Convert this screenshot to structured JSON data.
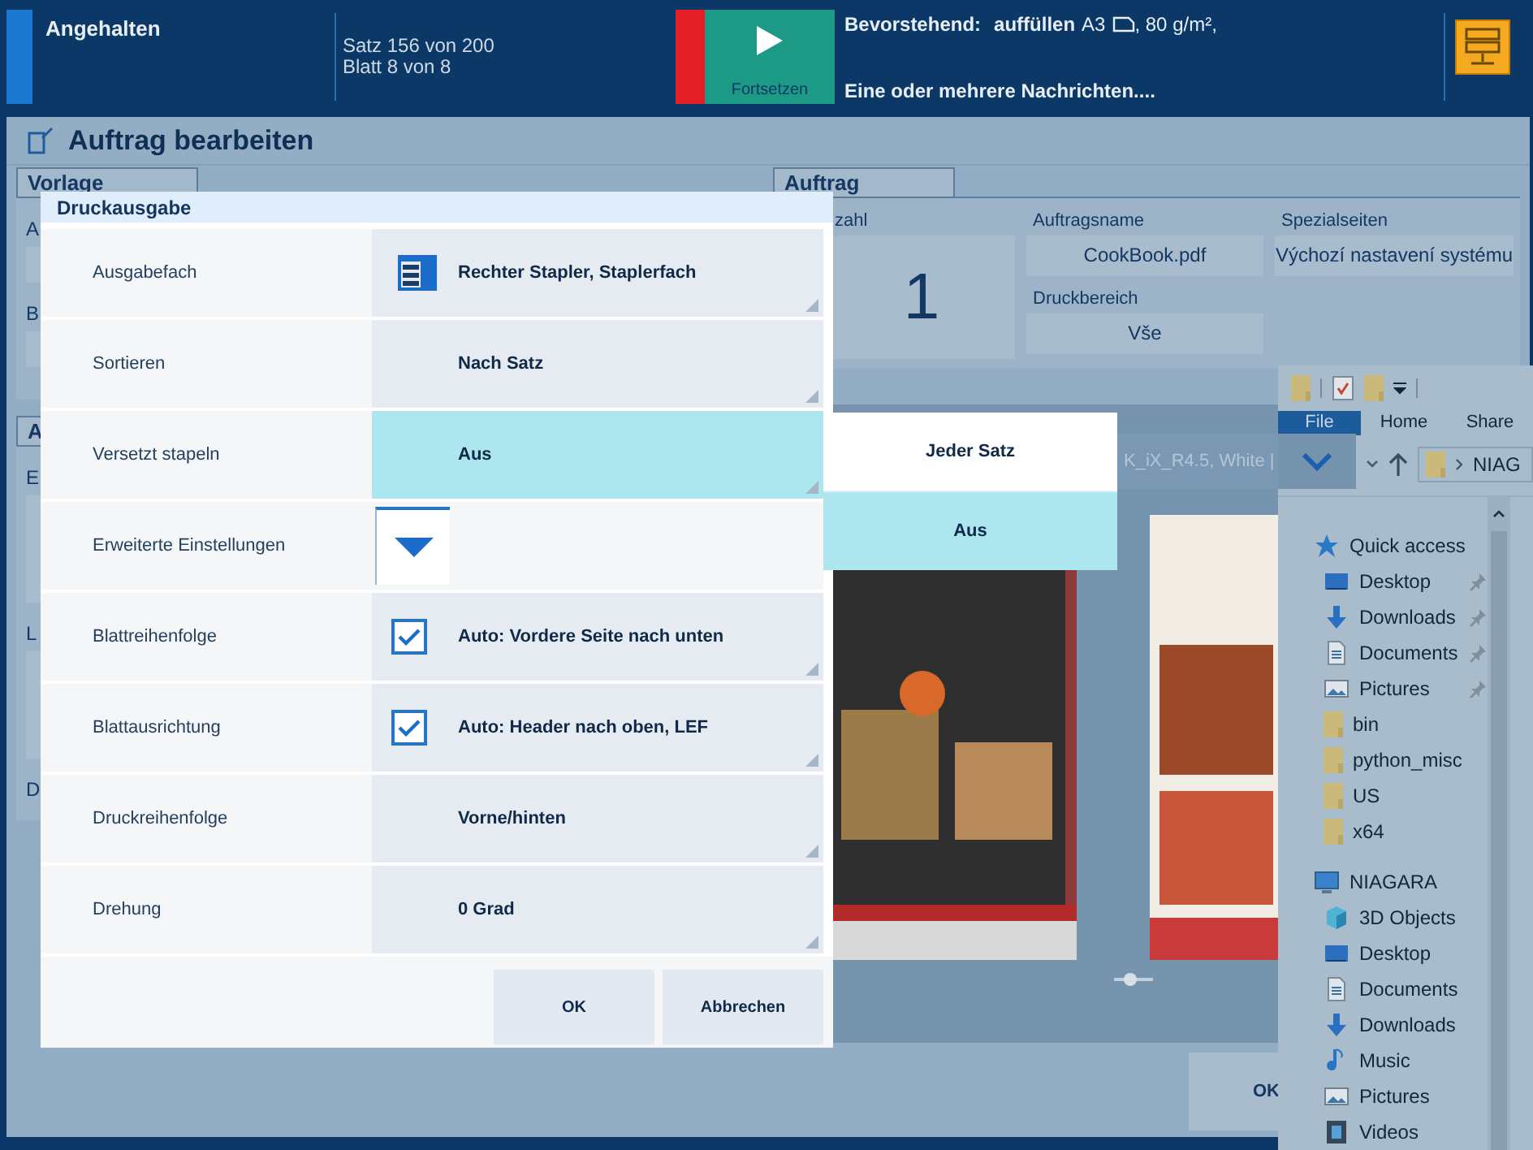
{
  "status_bar": {
    "state": "Angehalten",
    "progress": [
      "Satz 156 von 200",
      "Blatt 8 von 8"
    ],
    "resume_button": "Fortsetzen",
    "upcoming_label": "Bevorstehend:",
    "upcoming_action": "auffüllen",
    "upcoming_size": "A3",
    "upcoming_weight": ", 80 g/m²,",
    "message": "Eine oder mehrere Nachrichten...."
  },
  "window": {
    "title": "Auftrag bearbeiten"
  },
  "vorlage": {
    "tab": "Vorlage",
    "labels": [
      "A",
      "B"
    ],
    "second_tab": "A",
    "second_labels": [
      "E",
      "L",
      "D"
    ]
  },
  "auftrag": {
    "tab": "Auftrag",
    "fields": [
      {
        "label": "zahl",
        "value": "1",
        "kind": "big"
      },
      {
        "label": "Auftragsname",
        "value": "CookBook.pdf",
        "kind": "text"
      },
      {
        "label": "Spezialseiten",
        "value": "Výchozí nastavení systému",
        "kind": "text"
      },
      {
        "label": "Druckbereich",
        "value": "Vše",
        "kind": "text"
      }
    ]
  },
  "preview": {
    "caption": "K_iX_R4.5, White |"
  },
  "footer_button": "OK",
  "dialog": {
    "title": "Druckausgabe",
    "rows": [
      {
        "label": "Ausgabefach",
        "value": "Rechter Stapler, Staplerfach",
        "kind": "icon",
        "selected": false
      },
      {
        "label": "Sortieren",
        "value": "Nach Satz",
        "kind": "plain",
        "selected": false
      },
      {
        "label": "Versetzt stapeln",
        "value": "Aus",
        "kind": "plain",
        "selected": true
      },
      {
        "label": "Erweiterte Einstellungen",
        "kind": "expander",
        "selected": false
      },
      {
        "label": "Blattreihenfolge",
        "value": "Auto: Vordere Seite nach unten",
        "kind": "check",
        "checked": true,
        "selected": false
      },
      {
        "label": "Blattausrichtung",
        "value": "Auto: Header nach oben, LEF",
        "kind": "check",
        "checked": true,
        "selected": false
      },
      {
        "label": "Druckreihenfolge",
        "value": "Vorne/hinten",
        "kind": "plain",
        "selected": false
      },
      {
        "label": "Drehung",
        "value": "0 Grad",
        "kind": "plain",
        "selected": false
      }
    ],
    "buttons": [
      "OK",
      "Abbrechen"
    ]
  },
  "dropdown": [
    {
      "label": "Jeder Satz",
      "selected": false
    },
    {
      "label": "Aus",
      "selected": true
    }
  ],
  "explorer": {
    "tabs": [
      {
        "label": "File",
        "selected": true
      },
      {
        "label": "Home",
        "selected": false
      },
      {
        "label": "Share",
        "selected": false
      }
    ],
    "path": "NIAG",
    "nav": [
      {
        "label": "Quick access",
        "kind": "star",
        "children": [
          {
            "label": "Desktop",
            "kind": "desktop",
            "pinned": true
          },
          {
            "label": "Downloads",
            "kind": "download",
            "pinned": true
          },
          {
            "label": "Documents",
            "kind": "document",
            "pinned": true
          },
          {
            "label": "Pictures",
            "kind": "picture",
            "pinned": true
          },
          {
            "label": "bin",
            "kind": "folder",
            "pinned": false
          },
          {
            "label": "python_misc",
            "kind": "folder",
            "pinned": false
          },
          {
            "label": "US",
            "kind": "folder",
            "pinned": false
          },
          {
            "label": "x64",
            "kind": "folder",
            "pinned": false
          }
        ]
      },
      {
        "label": "NIAGARA",
        "kind": "computer",
        "children": [
          {
            "label": "3D Objects",
            "kind": "cube",
            "pinned": false
          },
          {
            "label": "Desktop",
            "kind": "desktop",
            "pinned": false
          },
          {
            "label": "Documents",
            "kind": "document",
            "pinned": false
          },
          {
            "label": "Downloads",
            "kind": "download",
            "pinned": false
          },
          {
            "label": "Music",
            "kind": "music",
            "pinned": false
          },
          {
            "label": "Pictures",
            "kind": "picture",
            "pinned": false
          },
          {
            "label": "Videos",
            "kind": "video",
            "pinned": false
          }
        ]
      }
    ]
  }
}
